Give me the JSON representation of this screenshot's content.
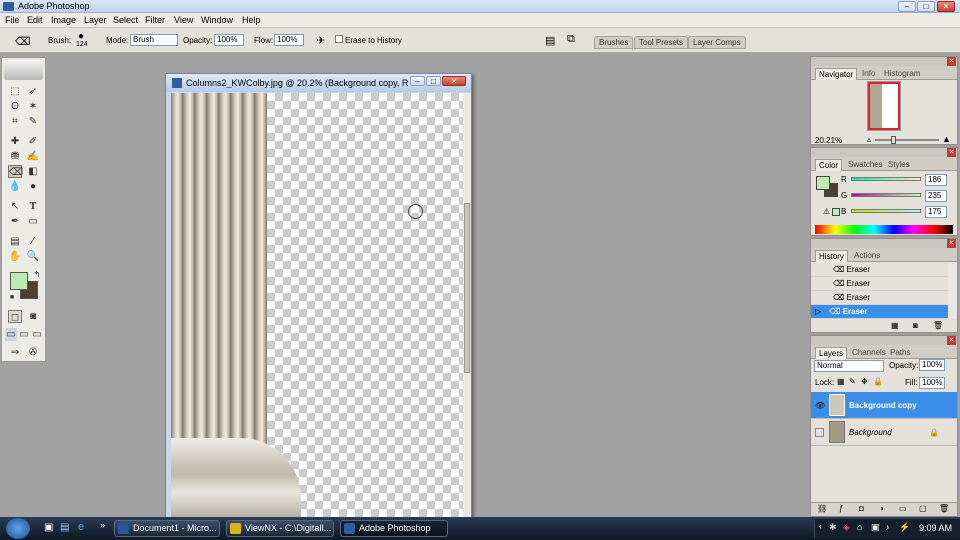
{
  "window": {
    "title": "Adobe Photoshop",
    "min": "–",
    "max": "□",
    "close": "✕"
  },
  "menu": [
    "File",
    "Edit",
    "Image",
    "Layer",
    "Select",
    "Filter",
    "View",
    "Window",
    "Help"
  ],
  "options": {
    "brush_label": "Brush:",
    "brush_size": "124",
    "mode_label": "Mode:",
    "mode_value": "Brush",
    "opacity_label": "Opacity:",
    "opacity_value": "100%",
    "flow_label": "Flow:",
    "flow_value": "100%",
    "erase_history": "Erase to History",
    "tabs": [
      "Brushes",
      "Tool Presets",
      "Layer Comps"
    ]
  },
  "document": {
    "title": "Columns2_KWColby.jpg @ 20.2% (Background copy, R..."
  },
  "navigator": {
    "tabs": [
      "Navigator",
      "Info",
      "Histogram"
    ],
    "zoom": "20.21%"
  },
  "color": {
    "tabs": [
      "Color",
      "Swatches",
      "Styles"
    ],
    "r_label": "R",
    "r": "186",
    "g_label": "G",
    "g": "235",
    "b_label": "B",
    "b": "175",
    "foreground": "#baebaf",
    "background": "#4d4030"
  },
  "history": {
    "tabs": [
      "History",
      "Actions"
    ],
    "items": [
      "Eraser",
      "Eraser",
      "Eraser",
      "Eraser"
    ]
  },
  "layers": {
    "tabs": [
      "Layers",
      "Channels",
      "Paths"
    ],
    "blend": "Normal",
    "opacity_label": "Opacity:",
    "opacity": "100%",
    "lock_label": "Lock:",
    "fill_label": "Fill:",
    "fill": "100%",
    "items": [
      "Background copy",
      "Background"
    ]
  },
  "taskbar": {
    "tasks": [
      "Document1 - Micro...",
      "ViewNX - C:\\DigitalI...",
      "Adobe Photoshop"
    ],
    "time": "9:09 AM"
  }
}
